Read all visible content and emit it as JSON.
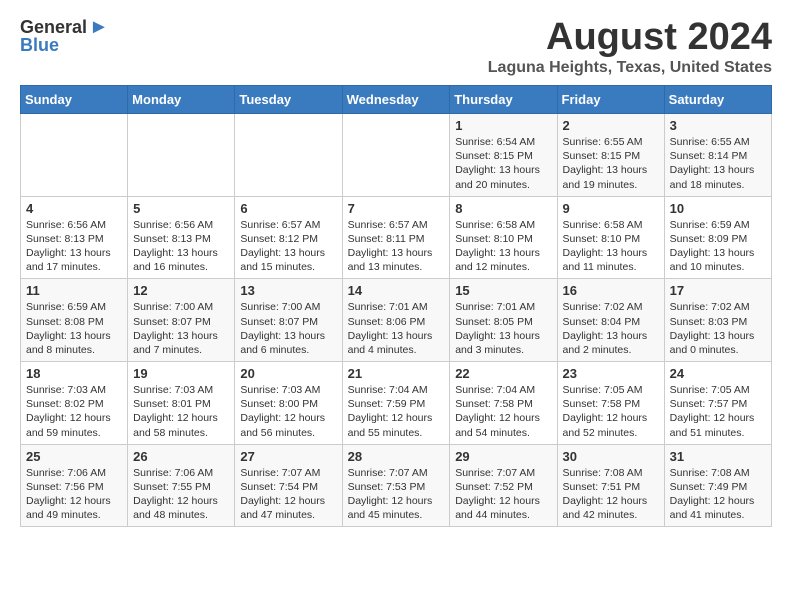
{
  "logo": {
    "general": "General",
    "blue": "Blue"
  },
  "title": "August 2024",
  "subtitle": "Laguna Heights, Texas, United States",
  "weekdays": [
    "Sunday",
    "Monday",
    "Tuesday",
    "Wednesday",
    "Thursday",
    "Friday",
    "Saturday"
  ],
  "weeks": [
    [
      {
        "day": "",
        "detail": ""
      },
      {
        "day": "",
        "detail": ""
      },
      {
        "day": "",
        "detail": ""
      },
      {
        "day": "",
        "detail": ""
      },
      {
        "day": "1",
        "detail": "Sunrise: 6:54 AM\nSunset: 8:15 PM\nDaylight: 13 hours\nand 20 minutes."
      },
      {
        "day": "2",
        "detail": "Sunrise: 6:55 AM\nSunset: 8:15 PM\nDaylight: 13 hours\nand 19 minutes."
      },
      {
        "day": "3",
        "detail": "Sunrise: 6:55 AM\nSunset: 8:14 PM\nDaylight: 13 hours\nand 18 minutes."
      }
    ],
    [
      {
        "day": "4",
        "detail": "Sunrise: 6:56 AM\nSunset: 8:13 PM\nDaylight: 13 hours\nand 17 minutes."
      },
      {
        "day": "5",
        "detail": "Sunrise: 6:56 AM\nSunset: 8:13 PM\nDaylight: 13 hours\nand 16 minutes."
      },
      {
        "day": "6",
        "detail": "Sunrise: 6:57 AM\nSunset: 8:12 PM\nDaylight: 13 hours\nand 15 minutes."
      },
      {
        "day": "7",
        "detail": "Sunrise: 6:57 AM\nSunset: 8:11 PM\nDaylight: 13 hours\nand 13 minutes."
      },
      {
        "day": "8",
        "detail": "Sunrise: 6:58 AM\nSunset: 8:10 PM\nDaylight: 13 hours\nand 12 minutes."
      },
      {
        "day": "9",
        "detail": "Sunrise: 6:58 AM\nSunset: 8:10 PM\nDaylight: 13 hours\nand 11 minutes."
      },
      {
        "day": "10",
        "detail": "Sunrise: 6:59 AM\nSunset: 8:09 PM\nDaylight: 13 hours\nand 10 minutes."
      }
    ],
    [
      {
        "day": "11",
        "detail": "Sunrise: 6:59 AM\nSunset: 8:08 PM\nDaylight: 13 hours\nand 8 minutes."
      },
      {
        "day": "12",
        "detail": "Sunrise: 7:00 AM\nSunset: 8:07 PM\nDaylight: 13 hours\nand 7 minutes."
      },
      {
        "day": "13",
        "detail": "Sunrise: 7:00 AM\nSunset: 8:07 PM\nDaylight: 13 hours\nand 6 minutes."
      },
      {
        "day": "14",
        "detail": "Sunrise: 7:01 AM\nSunset: 8:06 PM\nDaylight: 13 hours\nand 4 minutes."
      },
      {
        "day": "15",
        "detail": "Sunrise: 7:01 AM\nSunset: 8:05 PM\nDaylight: 13 hours\nand 3 minutes."
      },
      {
        "day": "16",
        "detail": "Sunrise: 7:02 AM\nSunset: 8:04 PM\nDaylight: 13 hours\nand 2 minutes."
      },
      {
        "day": "17",
        "detail": "Sunrise: 7:02 AM\nSunset: 8:03 PM\nDaylight: 13 hours\nand 0 minutes."
      }
    ],
    [
      {
        "day": "18",
        "detail": "Sunrise: 7:03 AM\nSunset: 8:02 PM\nDaylight: 12 hours\nand 59 minutes."
      },
      {
        "day": "19",
        "detail": "Sunrise: 7:03 AM\nSunset: 8:01 PM\nDaylight: 12 hours\nand 58 minutes."
      },
      {
        "day": "20",
        "detail": "Sunrise: 7:03 AM\nSunset: 8:00 PM\nDaylight: 12 hours\nand 56 minutes."
      },
      {
        "day": "21",
        "detail": "Sunrise: 7:04 AM\nSunset: 7:59 PM\nDaylight: 12 hours\nand 55 minutes."
      },
      {
        "day": "22",
        "detail": "Sunrise: 7:04 AM\nSunset: 7:58 PM\nDaylight: 12 hours\nand 54 minutes."
      },
      {
        "day": "23",
        "detail": "Sunrise: 7:05 AM\nSunset: 7:58 PM\nDaylight: 12 hours\nand 52 minutes."
      },
      {
        "day": "24",
        "detail": "Sunrise: 7:05 AM\nSunset: 7:57 PM\nDaylight: 12 hours\nand 51 minutes."
      }
    ],
    [
      {
        "day": "25",
        "detail": "Sunrise: 7:06 AM\nSunset: 7:56 PM\nDaylight: 12 hours\nand 49 minutes."
      },
      {
        "day": "26",
        "detail": "Sunrise: 7:06 AM\nSunset: 7:55 PM\nDaylight: 12 hours\nand 48 minutes."
      },
      {
        "day": "27",
        "detail": "Sunrise: 7:07 AM\nSunset: 7:54 PM\nDaylight: 12 hours\nand 47 minutes."
      },
      {
        "day": "28",
        "detail": "Sunrise: 7:07 AM\nSunset: 7:53 PM\nDaylight: 12 hours\nand 45 minutes."
      },
      {
        "day": "29",
        "detail": "Sunrise: 7:07 AM\nSunset: 7:52 PM\nDaylight: 12 hours\nand 44 minutes."
      },
      {
        "day": "30",
        "detail": "Sunrise: 7:08 AM\nSunset: 7:51 PM\nDaylight: 12 hours\nand 42 minutes."
      },
      {
        "day": "31",
        "detail": "Sunrise: 7:08 AM\nSunset: 7:49 PM\nDaylight: 12 hours\nand 41 minutes."
      }
    ]
  ]
}
